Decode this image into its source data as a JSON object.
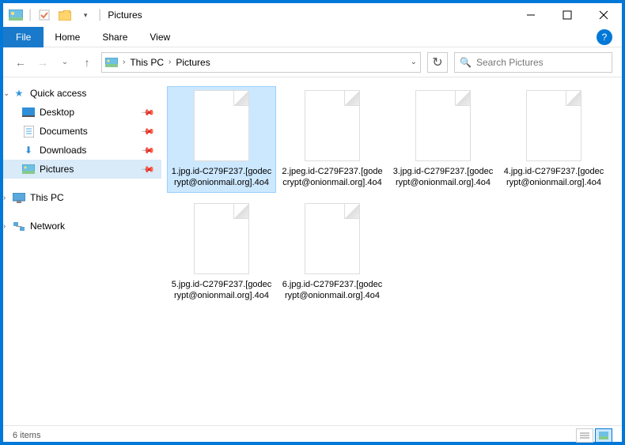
{
  "window": {
    "title": "Pictures"
  },
  "menu": {
    "file": "File",
    "home": "Home",
    "share": "Share",
    "view": "View"
  },
  "breadcrumb": {
    "root": "This PC",
    "current": "Pictures"
  },
  "search": {
    "placeholder": "Search Pictures"
  },
  "sidebar": {
    "quick_access": "Quick access",
    "desktop": "Desktop",
    "documents": "Documents",
    "downloads": "Downloads",
    "pictures": "Pictures",
    "this_pc": "This PC",
    "network": "Network"
  },
  "files": {
    "f0": "1.jpg.id-C279F237.[godecrypt@onionmail.org].4o4",
    "f1": "2.jpeg.id-C279F237.[godecrypt@onionmail.org].4o4",
    "f2": "3.jpg.id-C279F237.[godecrypt@onionmail.org].4o4",
    "f3": "4.jpg.id-C279F237.[godecrypt@onionmail.org].4o4",
    "f4": "5.jpg.id-C279F237.[godecrypt@onionmail.org].4o4",
    "f5": "6.jpg.id-C279F237.[godecrypt@onionmail.org].4o4"
  },
  "status": {
    "count": "6 items"
  }
}
